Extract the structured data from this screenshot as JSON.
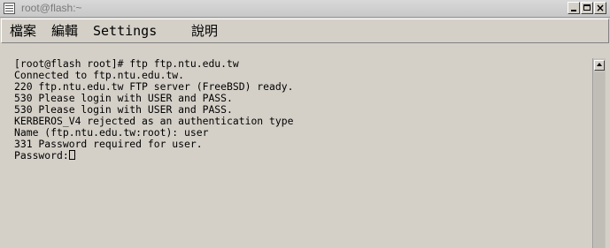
{
  "window": {
    "title": "root@flash:~"
  },
  "menu": {
    "items": [
      "檔案",
      "編輯",
      "Settings",
      "說明"
    ]
  },
  "terminal": {
    "lines": [
      "[root@flash root]# ftp ftp.ntu.edu.tw",
      "Connected to ftp.ntu.edu.tw.",
      "220 ftp.ntu.edu.tw FTP server (FreeBSD) ready.",
      "530 Please login with USER and PASS.",
      "530 Please login with USER and PASS.",
      "KERBEROS_V4 rejected as an authentication type",
      "Name (ftp.ntu.edu.tw:root): user",
      "331 Password required for user.",
      "Password:"
    ]
  },
  "icons": {
    "window_menu": "window-menu-icon",
    "minimize": "minimize-icon",
    "maximize": "maximize-icon",
    "close": "close-icon",
    "scroll_up": "scroll-up-arrow-icon"
  }
}
